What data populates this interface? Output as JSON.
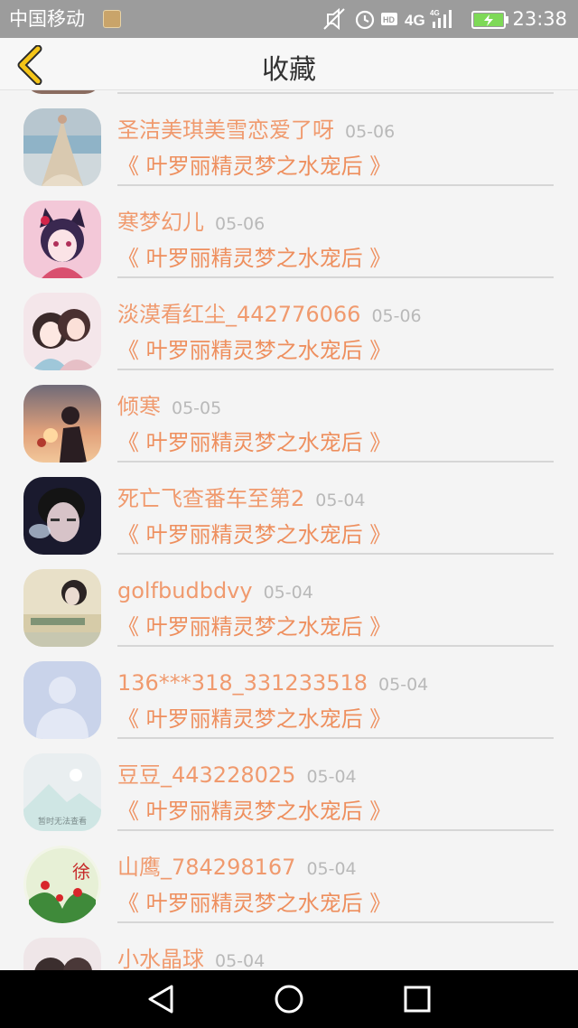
{
  "status_bar": {
    "carrier": "中国移动",
    "network": "4G",
    "time": "23:38"
  },
  "header": {
    "title": "收藏"
  },
  "colors": {
    "accent": "#f09a6e",
    "back_icon": "#f5c518",
    "date": "#b9b9b9"
  },
  "favorites": [
    {
      "name": "圣洁美琪美雪恋爱了呀",
      "date": "05-06",
      "book": "《 叶罗丽精灵梦之水宠后 》",
      "avatar": "avatar-wedding-dress"
    },
    {
      "name": "寒梦幻儿",
      "date": "05-06",
      "book": "《 叶罗丽精灵梦之水宠后 》",
      "avatar": "avatar-anime-cat-girl"
    },
    {
      "name": "淡漠看红尘_442776066",
      "date": "05-06",
      "book": "《 叶罗丽精灵梦之水宠后 》",
      "avatar": "avatar-anime-couple"
    },
    {
      "name": "倾寒",
      "date": "05-05",
      "book": "《 叶罗丽精灵梦之水宠后 》",
      "avatar": "avatar-sunset-silhouette"
    },
    {
      "name": "死亡飞查番车至第2",
      "date": "05-04",
      "book": "《 叶罗丽精灵梦之水宠后 》",
      "avatar": "avatar-boy-portrait"
    },
    {
      "name": "golfbudbdvy",
      "date": "05-04",
      "book": "《 叶罗丽精灵梦之水宠后 》",
      "avatar": "avatar-girl-text-photo"
    },
    {
      "name": "136***318_331233518",
      "date": "05-04",
      "book": "《 叶罗丽精灵梦之水宠后 》",
      "avatar": "avatar-default-person"
    },
    {
      "name": "豆豆_443228025",
      "date": "05-04",
      "book": "《 叶罗丽精灵梦之水宠后 》",
      "avatar": "avatar-image-unavailable",
      "avatar_caption": "暂时无法查看"
    },
    {
      "name": "山鹰_784298167",
      "date": "05-04",
      "book": "《 叶罗丽精灵梦之水宠后 》",
      "avatar": "avatar-flower-calligraphy",
      "avatar_caption": "徐"
    },
    {
      "name": "小水晶球",
      "date": "05-04",
      "book": "",
      "avatar": "avatar-partial"
    }
  ]
}
